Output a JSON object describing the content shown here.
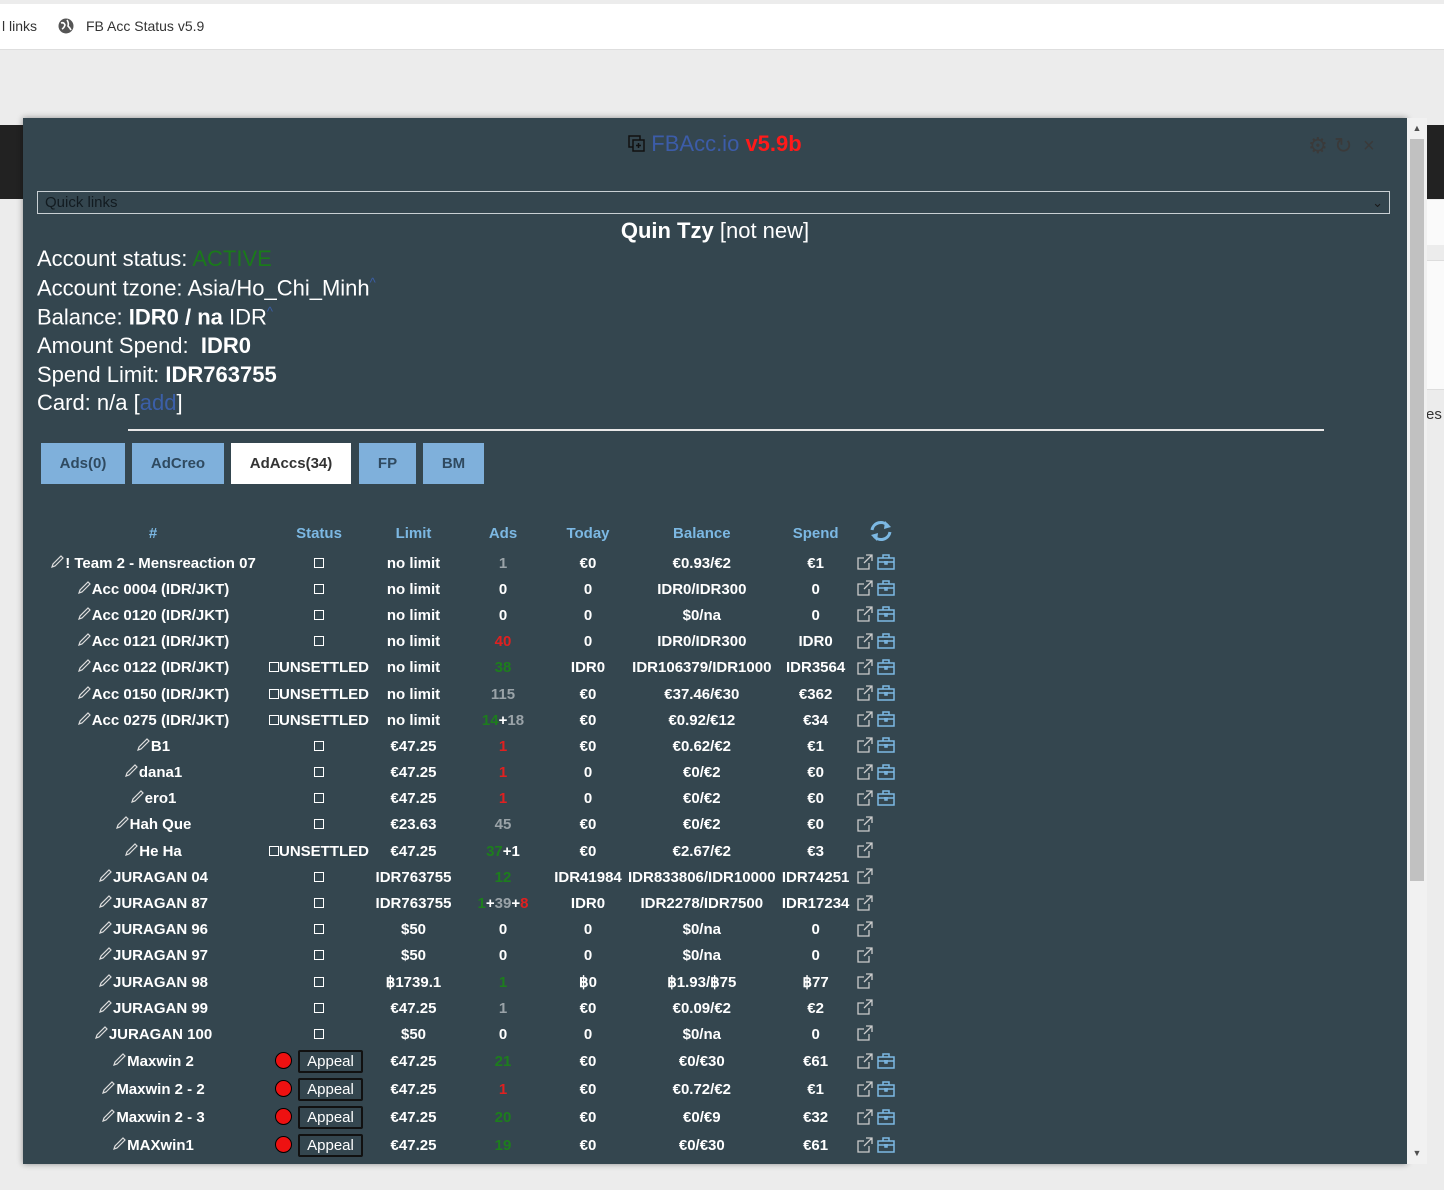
{
  "browser": {
    "bookmarks": [
      {
        "label": "l links"
      },
      {
        "label": "FB Acc Status v5.9"
      }
    ],
    "bg_peek_text": "es"
  },
  "modal": {
    "app_name": "FBAcc.io",
    "version": "v5.9b",
    "quick_links_placeholder": "Quick links",
    "account_name": "Quin Tzy",
    "account_tag": "[not new]",
    "status_label": "Account status:",
    "status_value": "ACTIVE",
    "tzone_label": "Account tzone:",
    "tzone_value": "Asia/Ho_Chi_Minh",
    "tzone_link": "^",
    "balance_label": "Balance:",
    "balance_value": "IDR0 / na",
    "balance_currency": "IDR",
    "balance_link": "^",
    "spend_label": "Amount Spend:",
    "spend_value": "IDR0",
    "limit_label": "Spend Limit:",
    "limit_value": "IDR763755",
    "card_label": "Card: n/a [",
    "card_link": "add",
    "card_close": "]",
    "tabs": [
      {
        "label": "Ads(0)",
        "active": false
      },
      {
        "label": "AdCreo",
        "active": false
      },
      {
        "label": "AdAccs(34)",
        "active": true
      },
      {
        "label": "FP",
        "active": false
      },
      {
        "label": "BM",
        "active": false
      }
    ],
    "columns": [
      "#",
      "Status",
      "Limit",
      "Ads",
      "Today",
      "Balance",
      "Spend"
    ],
    "rows": [
      {
        "name": "! Team 2 - Mensreaction 07",
        "status": "",
        "limit": "no limit",
        "ads": [
          {
            "t": "1",
            "c": "grey"
          }
        ],
        "today": "€0",
        "balance": "€0.93/€2",
        "spend": "€1",
        "bm": true
      },
      {
        "name": "Acc 0004 (IDR/JKT)",
        "status": "",
        "limit": "no limit",
        "ads": [
          {
            "t": "0",
            "c": "white"
          }
        ],
        "today": "0",
        "balance": "IDR0/IDR300",
        "spend": "0",
        "bm": true
      },
      {
        "name": "Acc 0120 (IDR/JKT)",
        "status": "",
        "limit": "no limit",
        "ads": [
          {
            "t": "0",
            "c": "white"
          }
        ],
        "today": "0",
        "balance": "$0/na",
        "spend": "0",
        "bm": true
      },
      {
        "name": "Acc 0121 (IDR/JKT)",
        "status": "",
        "limit": "no limit",
        "ads": [
          {
            "t": "40",
            "c": "red"
          }
        ],
        "today": "0",
        "balance": "IDR0/IDR300",
        "spend": "IDR0",
        "bm": true
      },
      {
        "name": "Acc 0122 (IDR/JKT)",
        "status": "UNSETTLED",
        "limit": "no limit",
        "ads": [
          {
            "t": "38",
            "c": "grn"
          }
        ],
        "today": "IDR0",
        "balance": "IDR106379/IDR1000",
        "spend": "IDR3564",
        "bm": true
      },
      {
        "name": "Acc 0150 (IDR/JKT)",
        "status": "UNSETTLED",
        "limit": "no limit",
        "ads": [
          {
            "t": "115",
            "c": "grey"
          }
        ],
        "today": "€0",
        "balance": "€37.46/€30",
        "spend": "€362",
        "bm": true
      },
      {
        "name": "Acc 0275 (IDR/JKT)",
        "status": "UNSETTLED",
        "limit": "no limit",
        "ads": [
          {
            "t": "14",
            "c": "grn"
          },
          {
            "t": "+",
            "c": "white"
          },
          {
            "t": "18",
            "c": "grey"
          }
        ],
        "today": "€0",
        "balance": "€0.92/€12",
        "spend": "€34",
        "bm": true
      },
      {
        "name": "B1",
        "status": "",
        "limit": "€47.25",
        "ads": [
          {
            "t": "1",
            "c": "red"
          }
        ],
        "today": "€0",
        "balance": "€0.62/€2",
        "spend": "€1",
        "bm": true
      },
      {
        "name": "dana1",
        "status": "",
        "limit": "€47.25",
        "ads": [
          {
            "t": "1",
            "c": "red"
          }
        ],
        "today": "0",
        "balance": "€0/€2",
        "spend": "€0",
        "bm": true
      },
      {
        "name": "ero1",
        "status": "",
        "limit": "€47.25",
        "ads": [
          {
            "t": "1",
            "c": "red"
          }
        ],
        "today": "0",
        "balance": "€0/€2",
        "spend": "€0",
        "bm": true
      },
      {
        "name": "Hah Que",
        "status": "",
        "limit": "€23.63",
        "ads": [
          {
            "t": "45",
            "c": "grey"
          }
        ],
        "today": "€0",
        "balance": "€0/€2",
        "spend": "€0",
        "bm": false
      },
      {
        "name": "He Ha",
        "status": "UNSETTLED",
        "limit": "€47.25",
        "ads": [
          {
            "t": "37",
            "c": "grn"
          },
          {
            "t": "+1",
            "c": "white"
          }
        ],
        "today": "€0",
        "balance": "€2.67/€2",
        "spend": "€3",
        "bm": false
      },
      {
        "name": "JURAGAN 04",
        "status": "",
        "limit": "IDR763755",
        "ads": [
          {
            "t": "12",
            "c": "grn"
          }
        ],
        "today": "IDR41984",
        "balance": "IDR833806/IDR10000",
        "spend": "IDR74251",
        "bm": false
      },
      {
        "name": "JURAGAN 87",
        "status": "",
        "limit": "IDR763755",
        "ads": [
          {
            "t": "1",
            "c": "grn"
          },
          {
            "t": "+",
            "c": "white"
          },
          {
            "t": "39",
            "c": "grey"
          },
          {
            "t": "+",
            "c": "white"
          },
          {
            "t": "8",
            "c": "red"
          }
        ],
        "today": "IDR0",
        "balance": "IDR2278/IDR7500",
        "spend": "IDR17234",
        "bm": false
      },
      {
        "name": "JURAGAN 96",
        "status": "",
        "limit": "$50",
        "ads": [
          {
            "t": "0",
            "c": "white"
          }
        ],
        "today": "0",
        "balance": "$0/na",
        "spend": "0",
        "bm": false
      },
      {
        "name": "JURAGAN 97",
        "status": "",
        "limit": "$50",
        "ads": [
          {
            "t": "0",
            "c": "white"
          }
        ],
        "today": "0",
        "balance": "$0/na",
        "spend": "0",
        "bm": false
      },
      {
        "name": "JURAGAN 98",
        "status": "",
        "limit": "฿1739.1",
        "ads": [
          {
            "t": "1",
            "c": "grn"
          }
        ],
        "today": "฿0",
        "balance": "฿1.93/฿75",
        "spend": "฿77",
        "bm": false
      },
      {
        "name": "JURAGAN 99",
        "status": "",
        "limit": "€47.25",
        "ads": [
          {
            "t": "1",
            "c": "grey"
          }
        ],
        "today": "€0",
        "balance": "€0.09/€2",
        "spend": "€2",
        "bm": false
      },
      {
        "name": "JURAGAN 100",
        "status": "",
        "limit": "$50",
        "ads": [
          {
            "t": "0",
            "c": "white"
          }
        ],
        "today": "0",
        "balance": "$0/na",
        "spend": "0",
        "bm": false
      },
      {
        "name": "Maxwin 2",
        "status": "appeal",
        "limit": "€47.25",
        "ads": [
          {
            "t": "21",
            "c": "grn"
          }
        ],
        "today": "€0",
        "balance": "€0/€30",
        "spend": "€61",
        "bm": true
      },
      {
        "name": "Maxwin 2 - 2",
        "status": "appeal",
        "limit": "€47.25",
        "ads": [
          {
            "t": "1",
            "c": "red"
          }
        ],
        "today": "€0",
        "balance": "€0.72/€2",
        "spend": "€1",
        "bm": true
      },
      {
        "name": "Maxwin 2 - 3",
        "status": "appeal",
        "limit": "€47.25",
        "ads": [
          {
            "t": "20",
            "c": "grn"
          }
        ],
        "today": "€0",
        "balance": "€0/€9",
        "spend": "€32",
        "bm": true
      },
      {
        "name": "MAXwin1",
        "status": "appeal",
        "limit": "€47.25",
        "ads": [
          {
            "t": "19",
            "c": "grn"
          }
        ],
        "today": "€0",
        "balance": "€0/€30",
        "spend": "€61",
        "bm": true
      }
    ],
    "appeal_label": "Appeal",
    "unsettled_label": "UNSETTLED"
  },
  "colors": {
    "modal_bg": "#34464f",
    "header_blue": "#7cb8e3",
    "tab_blue": "#7fb0db",
    "active_green": "#1a7a1a",
    "version_red": "#ff1a1a"
  }
}
